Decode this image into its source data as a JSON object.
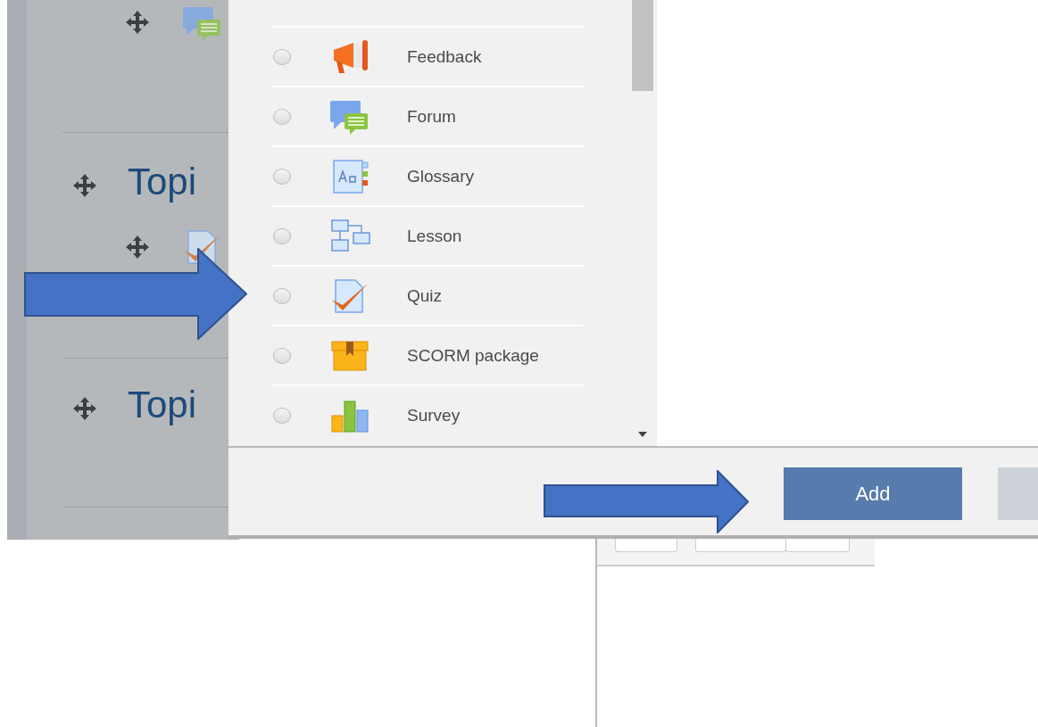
{
  "course": {
    "topics": [
      {
        "title": "Topi"
      },
      {
        "title": "Topi"
      }
    ]
  },
  "chooser": {
    "activities": [
      {
        "label": "Feedback",
        "kind": "feedback",
        "selected": false
      },
      {
        "label": "Forum",
        "kind": "forum",
        "selected": false
      },
      {
        "label": "Glossary",
        "kind": "glossary",
        "selected": false
      },
      {
        "label": "Lesson",
        "kind": "lesson",
        "selected": false
      },
      {
        "label": "Quiz",
        "kind": "quiz",
        "selected": false
      },
      {
        "label": "SCORM package",
        "kind": "scorm",
        "selected": false
      },
      {
        "label": "Survey",
        "kind": "survey",
        "selected": false
      }
    ],
    "buttons": [
      {
        "label": "Add",
        "kind": "primary"
      }
    ]
  }
}
